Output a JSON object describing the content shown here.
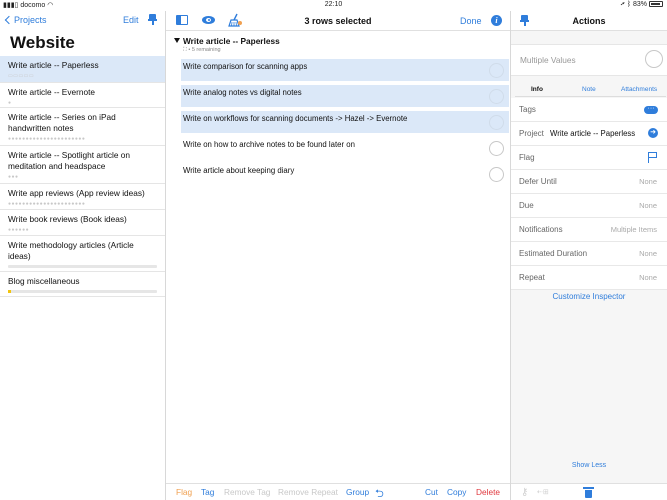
{
  "status": {
    "carrier": "docomo",
    "time": "22:10",
    "battery": "83%"
  },
  "left": {
    "back_label": "Projects",
    "edit_label": "Edit",
    "title": "Website",
    "projects": [
      {
        "label": "Write article -- Paperless",
        "selected": true
      },
      {
        "label": "Write article -- Evernote"
      },
      {
        "label": "Write article -- Series on iPad handwritten notes"
      },
      {
        "label": "Write article -- Spotlight article on meditation and headspace"
      },
      {
        "label": "Write app reviews (App review ideas)"
      },
      {
        "label": "Write book reviews (Book ideas)"
      },
      {
        "label": "Write methodology articles (Article ideas)"
      },
      {
        "label": "Blog miscellaneous"
      }
    ]
  },
  "middle": {
    "title": "3 rows selected",
    "done_label": "Done",
    "group_title": "Write article -- Paperless",
    "group_sub": "5 remaining",
    "tasks": [
      {
        "label": "Write comparison for scanning apps",
        "selected": true
      },
      {
        "label": "Write analog notes vs digital notes",
        "selected": true
      },
      {
        "label": "Write on workflows for scanning documents -> Hazel -> Evernote",
        "selected": true
      },
      {
        "label": "Write on how to archive notes to be found later on",
        "selected": false
      },
      {
        "label": "Write article about keeping diary",
        "selected": false
      }
    ],
    "bottom": {
      "flag": "Flag",
      "tag": "Tag",
      "remove_tag": "Remove Tag",
      "remove_repeat": "Remove Repeat",
      "group": "Group",
      "cut": "Cut",
      "copy": "Copy",
      "delete": "Delete"
    }
  },
  "right": {
    "title": "Actions",
    "multiple_values": "Multiple Values",
    "tabs": {
      "info": "Info",
      "note": "Note",
      "attachments": "Attachments"
    },
    "fields": {
      "tags": "Tags",
      "project_label": "Project",
      "project_value": "Write article -- Paperless",
      "flag": "Flag",
      "defer_label": "Defer Until",
      "defer_value": "None",
      "due_label": "Due",
      "due_value": "None",
      "notifications_label": "Notifications",
      "notifications_value": "Multiple Items",
      "duration_label": "Estimated Duration",
      "duration_value": "None",
      "repeat_label": "Repeat",
      "repeat_value": "None"
    },
    "customize": "Customize Inspector",
    "show_less": "Show Less"
  },
  "colors": {
    "accent": "#2f7ddb",
    "selection": "#dbe8f8",
    "flag_orange": "#f0a050",
    "delete_red": "#e0383e"
  }
}
